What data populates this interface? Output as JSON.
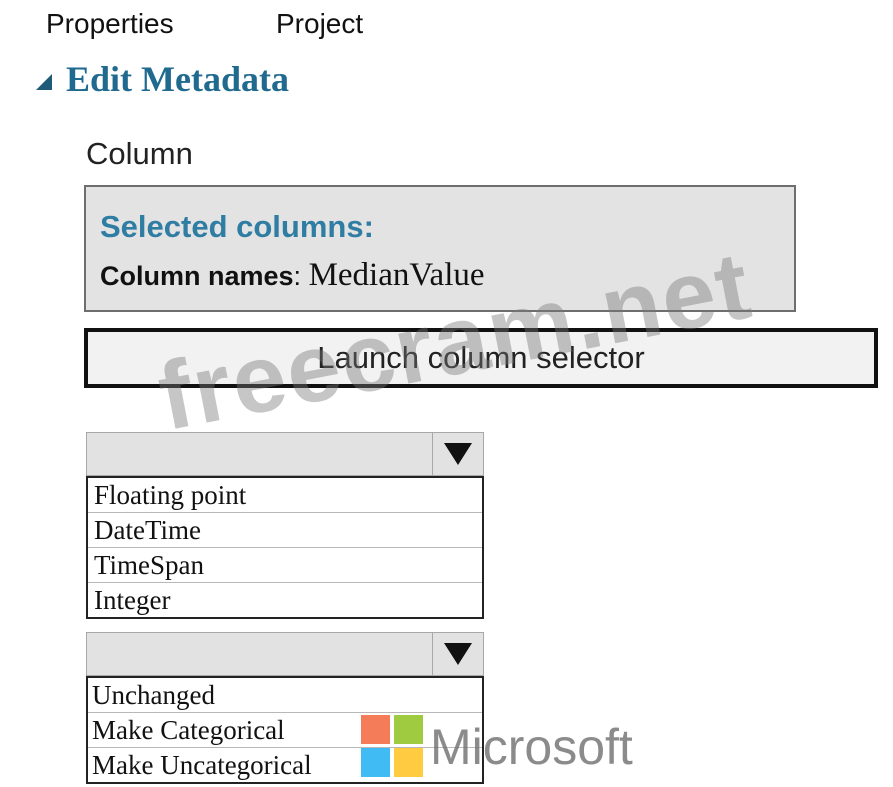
{
  "tabs": [
    {
      "label": "Properties"
    },
    {
      "label": "Project"
    }
  ],
  "section": {
    "title": "Edit Metadata"
  },
  "column": {
    "label": "Column",
    "selected_heading": "Selected columns:",
    "names_key": "Column names",
    "names_sep": ": ",
    "names_value": "MedianValue",
    "launch_label": "Launch column selector"
  },
  "dropdown_type": {
    "selected": "",
    "options": [
      "Floating point",
      "DateTime",
      "TimeSpan",
      "Integer"
    ]
  },
  "dropdown_categorical": {
    "selected": "",
    "options": [
      "Unchanged",
      "Make Categorical",
      "Make Uncategorical"
    ]
  },
  "watermarks": {
    "site": "freecram.net",
    "brand": "Microsoft",
    "logo_colors": [
      "#f25022",
      "#7fba00",
      "#00a4ef",
      "#ffb900"
    ]
  },
  "colors": {
    "title": "#1f6a8e",
    "heading": "#2f7da3",
    "panel": "#e3e3e3"
  }
}
